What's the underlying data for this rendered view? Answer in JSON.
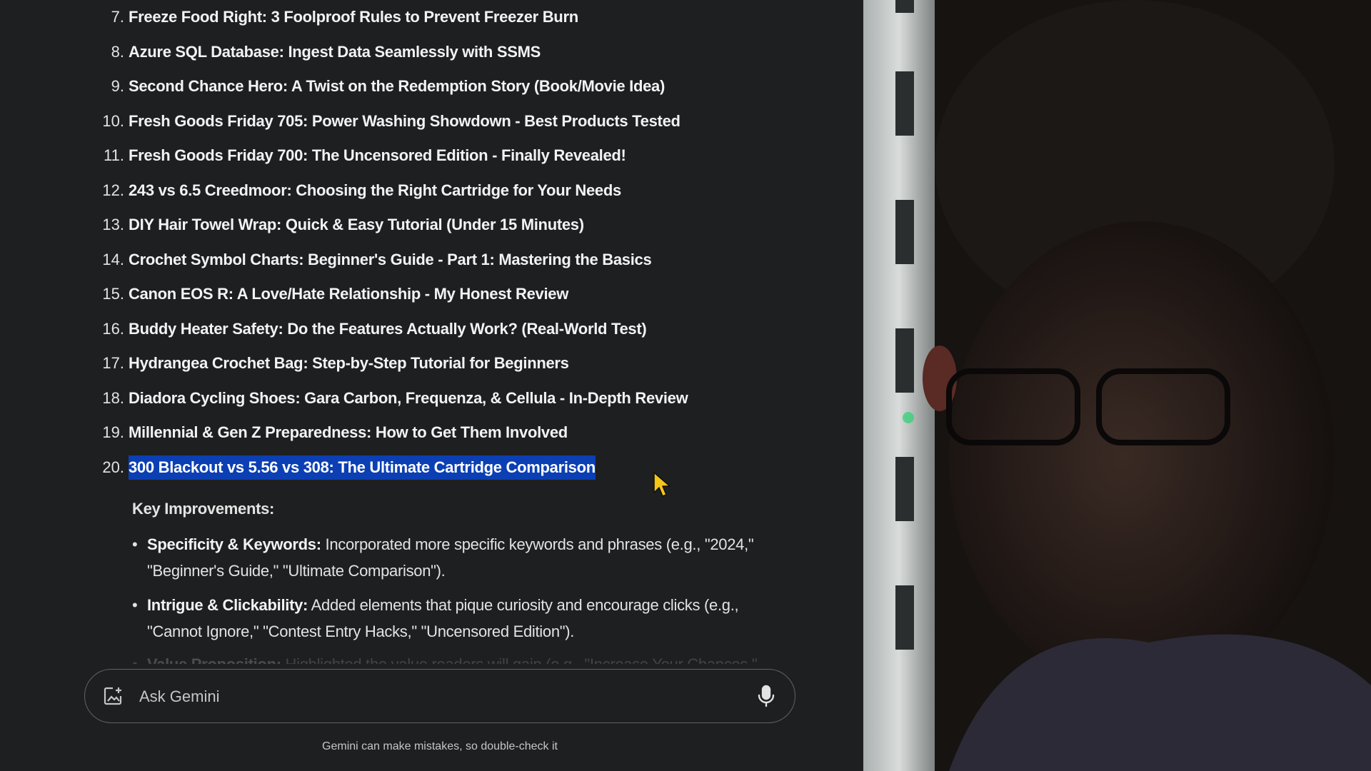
{
  "list": [
    {
      "num": "7.",
      "title": "Freeze Food Right: 3 Foolproof Rules to Prevent Freezer Burn"
    },
    {
      "num": "8.",
      "title": "Azure SQL Database: Ingest Data Seamlessly with SSMS"
    },
    {
      "num": "9.",
      "title": "Second Chance Hero: A Twist on the Redemption Story (Book/Movie Idea)"
    },
    {
      "num": "10.",
      "title": "Fresh Goods Friday 705: Power Washing Showdown - Best Products Tested"
    },
    {
      "num": "11.",
      "title": "Fresh Goods Friday 700: The Uncensored Edition - Finally Revealed!"
    },
    {
      "num": "12.",
      "title": "243 vs 6.5 Creedmoor: Choosing the Right Cartridge for Your Needs"
    },
    {
      "num": "13.",
      "title": "DIY Hair Towel Wrap: Quick & Easy Tutorial (Under 15 Minutes)"
    },
    {
      "num": "14.",
      "title": "Crochet Symbol Charts: Beginner's Guide - Part 1: Mastering the Basics"
    },
    {
      "num": "15.",
      "title": "Canon EOS R: A Love/Hate Relationship - My Honest Review"
    },
    {
      "num": "16.",
      "title": "Buddy Heater Safety: Do the Features Actually Work? (Real-World Test)"
    },
    {
      "num": "17.",
      "title": "Hydrangea Crochet Bag: Step-by-Step Tutorial for Beginners"
    },
    {
      "num": "18.",
      "title": "Diadora Cycling Shoes: Gara Carbon, Frequenza, & Cellula - In-Depth Review"
    },
    {
      "num": "19.",
      "title": "Millennial & Gen Z Preparedness: How to Get Them Involved"
    },
    {
      "num": "20.",
      "title": "300 Blackout vs 5.56 vs 308: The Ultimate Cartridge Comparison",
      "selected": true
    }
  ],
  "key_improvements": {
    "heading": "Key Improvements:",
    "bullets": [
      {
        "label": "Specificity & Keywords:",
        "text": " Incorporated more specific keywords and phrases (e.g., \"2024,\" \"Beginner's Guide,\" \"Ultimate Comparison\")."
      },
      {
        "label": "Intrigue & Clickability:",
        "text": " Added elements that pique curiosity and encourage clicks (e.g., \"Cannot Ignore,\" \"Contest Entry Hacks,\" \"Uncensored Edition\")."
      },
      {
        "label": "Value Proposition:",
        "text": " Highlighted the value readers will gain (e.g., \"Increase Your Chances,\""
      }
    ]
  },
  "composer": {
    "placeholder": "Ask Gemini",
    "upload_icon": "image-upload-icon",
    "mic_icon": "microphone-icon"
  },
  "disclaimer": "Gemini can make mistakes, so double-check it",
  "colors": {
    "background": "#1e1f20",
    "selection": "#0b3fb3",
    "text": "#e3e3e3"
  }
}
